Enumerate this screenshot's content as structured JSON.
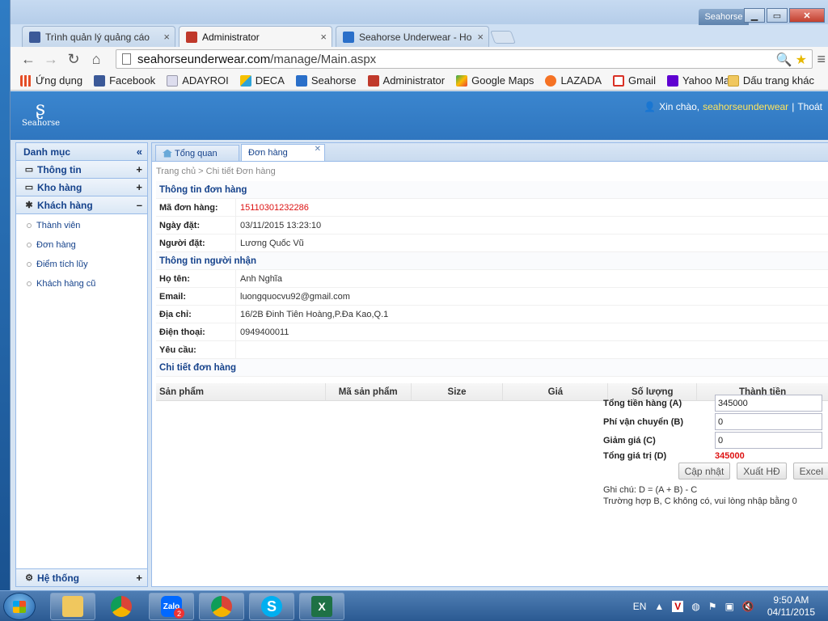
{
  "browser": {
    "tabs": [
      {
        "label": "Trình quản lý quảng cáo",
        "icon": "facebook-icon",
        "color": "#3b5998"
      },
      {
        "label": "Administrator",
        "icon": "admin-icon",
        "color": "#c0392b"
      },
      {
        "label": "Seahorse Underwear - Ho",
        "icon": "seahorse-icon",
        "color": "#2a6fc9"
      }
    ],
    "window_label": "Seahorse",
    "url_host": "seahorseunderwear.com",
    "url_path": "/manage/Main.aspx",
    "bookmarks": [
      {
        "label": "Ứng dụng",
        "color": "#e44d26"
      },
      {
        "label": "Facebook",
        "color": "#3b5998"
      },
      {
        "label": "ADAYROI",
        "color": "#9aa"
      },
      {
        "label": "DECA",
        "color": "#2ea3d8"
      },
      {
        "label": "Seahorse",
        "color": "#2a6fc9"
      },
      {
        "label": "Administrator",
        "color": "#c0392b"
      },
      {
        "label": "Google Maps",
        "color": "#34a853"
      },
      {
        "label": "LAZADA",
        "color": "#f57224"
      },
      {
        "label": "Gmail",
        "color": "#d93025"
      },
      {
        "label": "Yahoo Mail",
        "color": "#5f01d1"
      }
    ],
    "bookmark_folder": "Dấu trang khác"
  },
  "app": {
    "logo_text": "Seahorse",
    "greeting_prefix": "Xin chào,",
    "username": "seahorseunderwear",
    "separator": "|",
    "logout": "Thoát"
  },
  "sidebar": {
    "title": "Danh mục",
    "groups": [
      {
        "label": "Thông tin",
        "state": "+"
      },
      {
        "label": "Kho hàng",
        "state": "+"
      },
      {
        "label": "Khách hàng",
        "state": "–"
      }
    ],
    "items": [
      "Thành viên",
      "Đơn hàng",
      "Điểm tích lũy",
      "Khách hàng cũ"
    ],
    "bottom_group": {
      "label": "Hệ thống",
      "state": "+"
    }
  },
  "main": {
    "tabs": [
      {
        "label": "Tổng quan"
      },
      {
        "label": "Đơn hàng"
      }
    ],
    "breadcrumb": "Trang chủ > Chi tiết Đơn hàng",
    "order_section": "Thông tin đơn hàng",
    "order_fields": [
      {
        "label": "Mã đơn hàng:",
        "value": "15110301232286"
      },
      {
        "label": "Ngày đặt:",
        "value": "03/11/2015 13:23:10"
      },
      {
        "label": "Người đặt:",
        "value": "Lương Quốc Vũ"
      }
    ],
    "recipient_section": "Thông tin người nhận",
    "recipient_fields": [
      {
        "label": "Họ tên:",
        "value": "Anh Nghĩa"
      },
      {
        "label": "Email:",
        "value": "luongquocvu92@gmail.com"
      },
      {
        "label": "Địa chỉ:",
        "value": "16/2B Đinh Tiên Hoàng,P.Đa Kao,Q.1"
      },
      {
        "label": "Điện thoại:",
        "value": "0949400011"
      },
      {
        "label": "Yêu cầu:",
        "value": ""
      }
    ],
    "detail_section": "Chi tiết đơn hàng",
    "grid_columns": [
      "Sản phẩm",
      "Mã sản phẩm",
      "Size",
      "Giá",
      "Số lượng",
      "Thành tiền"
    ],
    "totals": {
      "subtotal_label": "Tổng tiền hàng (A)",
      "subtotal_value": "345000",
      "shipping_label": "Phí vận chuyển (B)",
      "shipping_value": "0",
      "discount_label": "Giảm giá (C)",
      "discount_value": "0",
      "total_label": "Tổng giá trị (D)",
      "total_value": "345000"
    },
    "buttons": {
      "update": "Cập nhật",
      "invoice": "Xuất HĐ",
      "excel": "Excel"
    },
    "note_line1": "Ghi chú: D = (A + B) - C",
    "note_line2": "Trường hợp B, C không có, vui lòng nhập bằng 0"
  },
  "taskbar": {
    "language": "EN",
    "time": "9:50 AM",
    "date": "04/11/2015",
    "zalo_badge": "2",
    "zalo_label": "Zalo"
  }
}
